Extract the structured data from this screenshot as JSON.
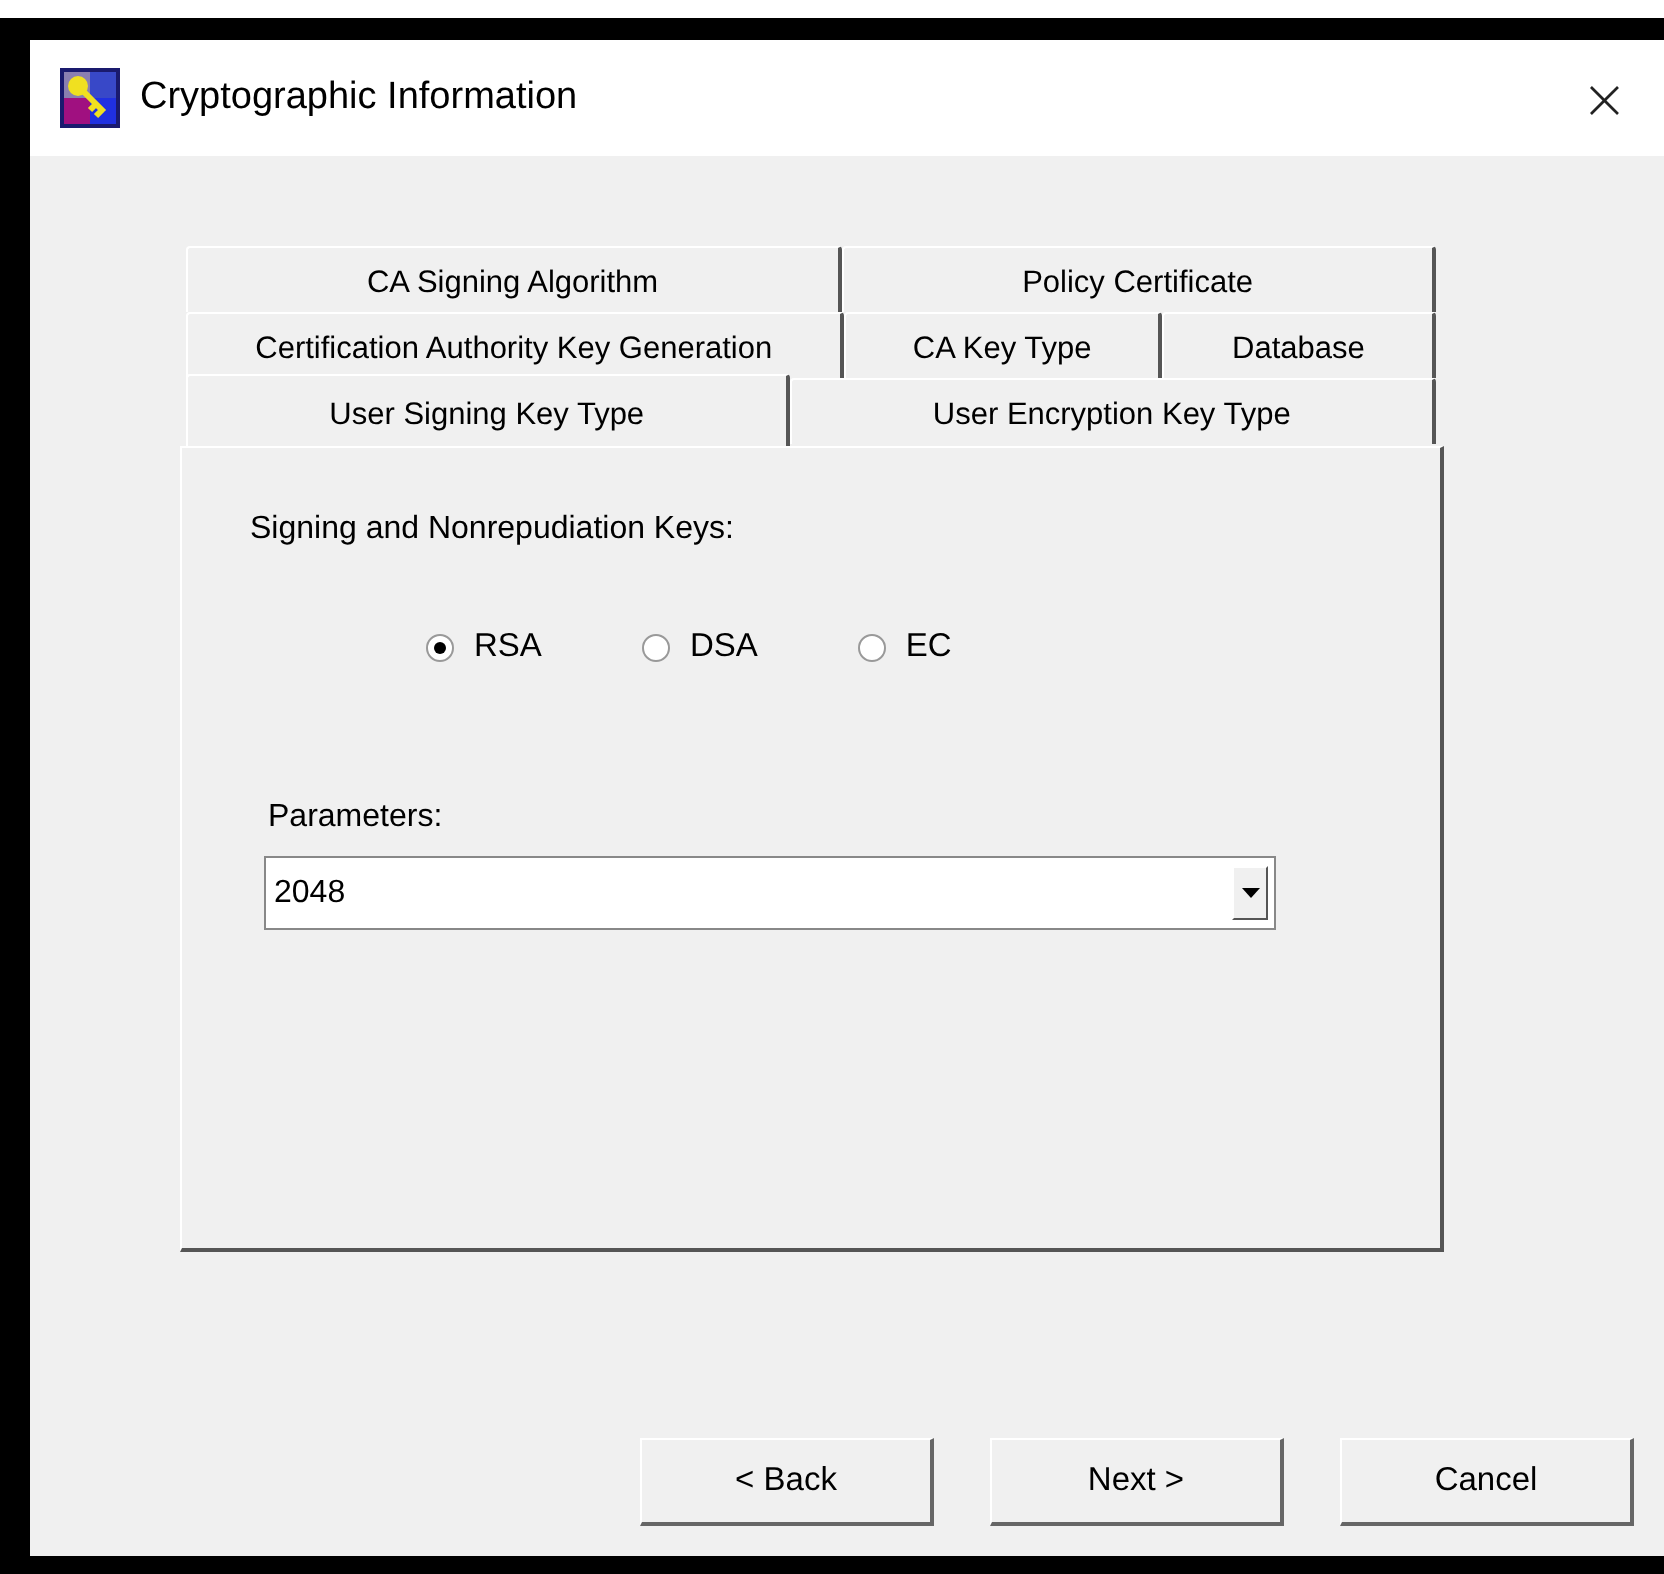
{
  "window": {
    "title": "Cryptographic Information",
    "close": "×"
  },
  "tab_rows": [
    [
      {
        "label": "CA Signing Algorithm",
        "selected": false
      },
      {
        "label": "Policy Certificate",
        "selected": false
      }
    ],
    [
      {
        "label": "Certification Authority Key Generation",
        "selected": false
      },
      {
        "label": "CA Key Type",
        "selected": false
      },
      {
        "label": "Database",
        "selected": false
      }
    ],
    [
      {
        "label": "User Signing Key Type",
        "selected": true
      },
      {
        "label": "User Encryption Key Type",
        "selected": false
      }
    ]
  ],
  "keys_label": "Signing and Nonrepudiation Keys:",
  "radios": [
    {
      "label": "RSA",
      "selected": true
    },
    {
      "label": "DSA",
      "selected": false
    },
    {
      "label": "EC",
      "selected": false
    }
  ],
  "parameters_label": "Parameters:",
  "parameters": {
    "value": "2048"
  },
  "buttons": [
    "< Back",
    "Next >",
    "Cancel"
  ]
}
